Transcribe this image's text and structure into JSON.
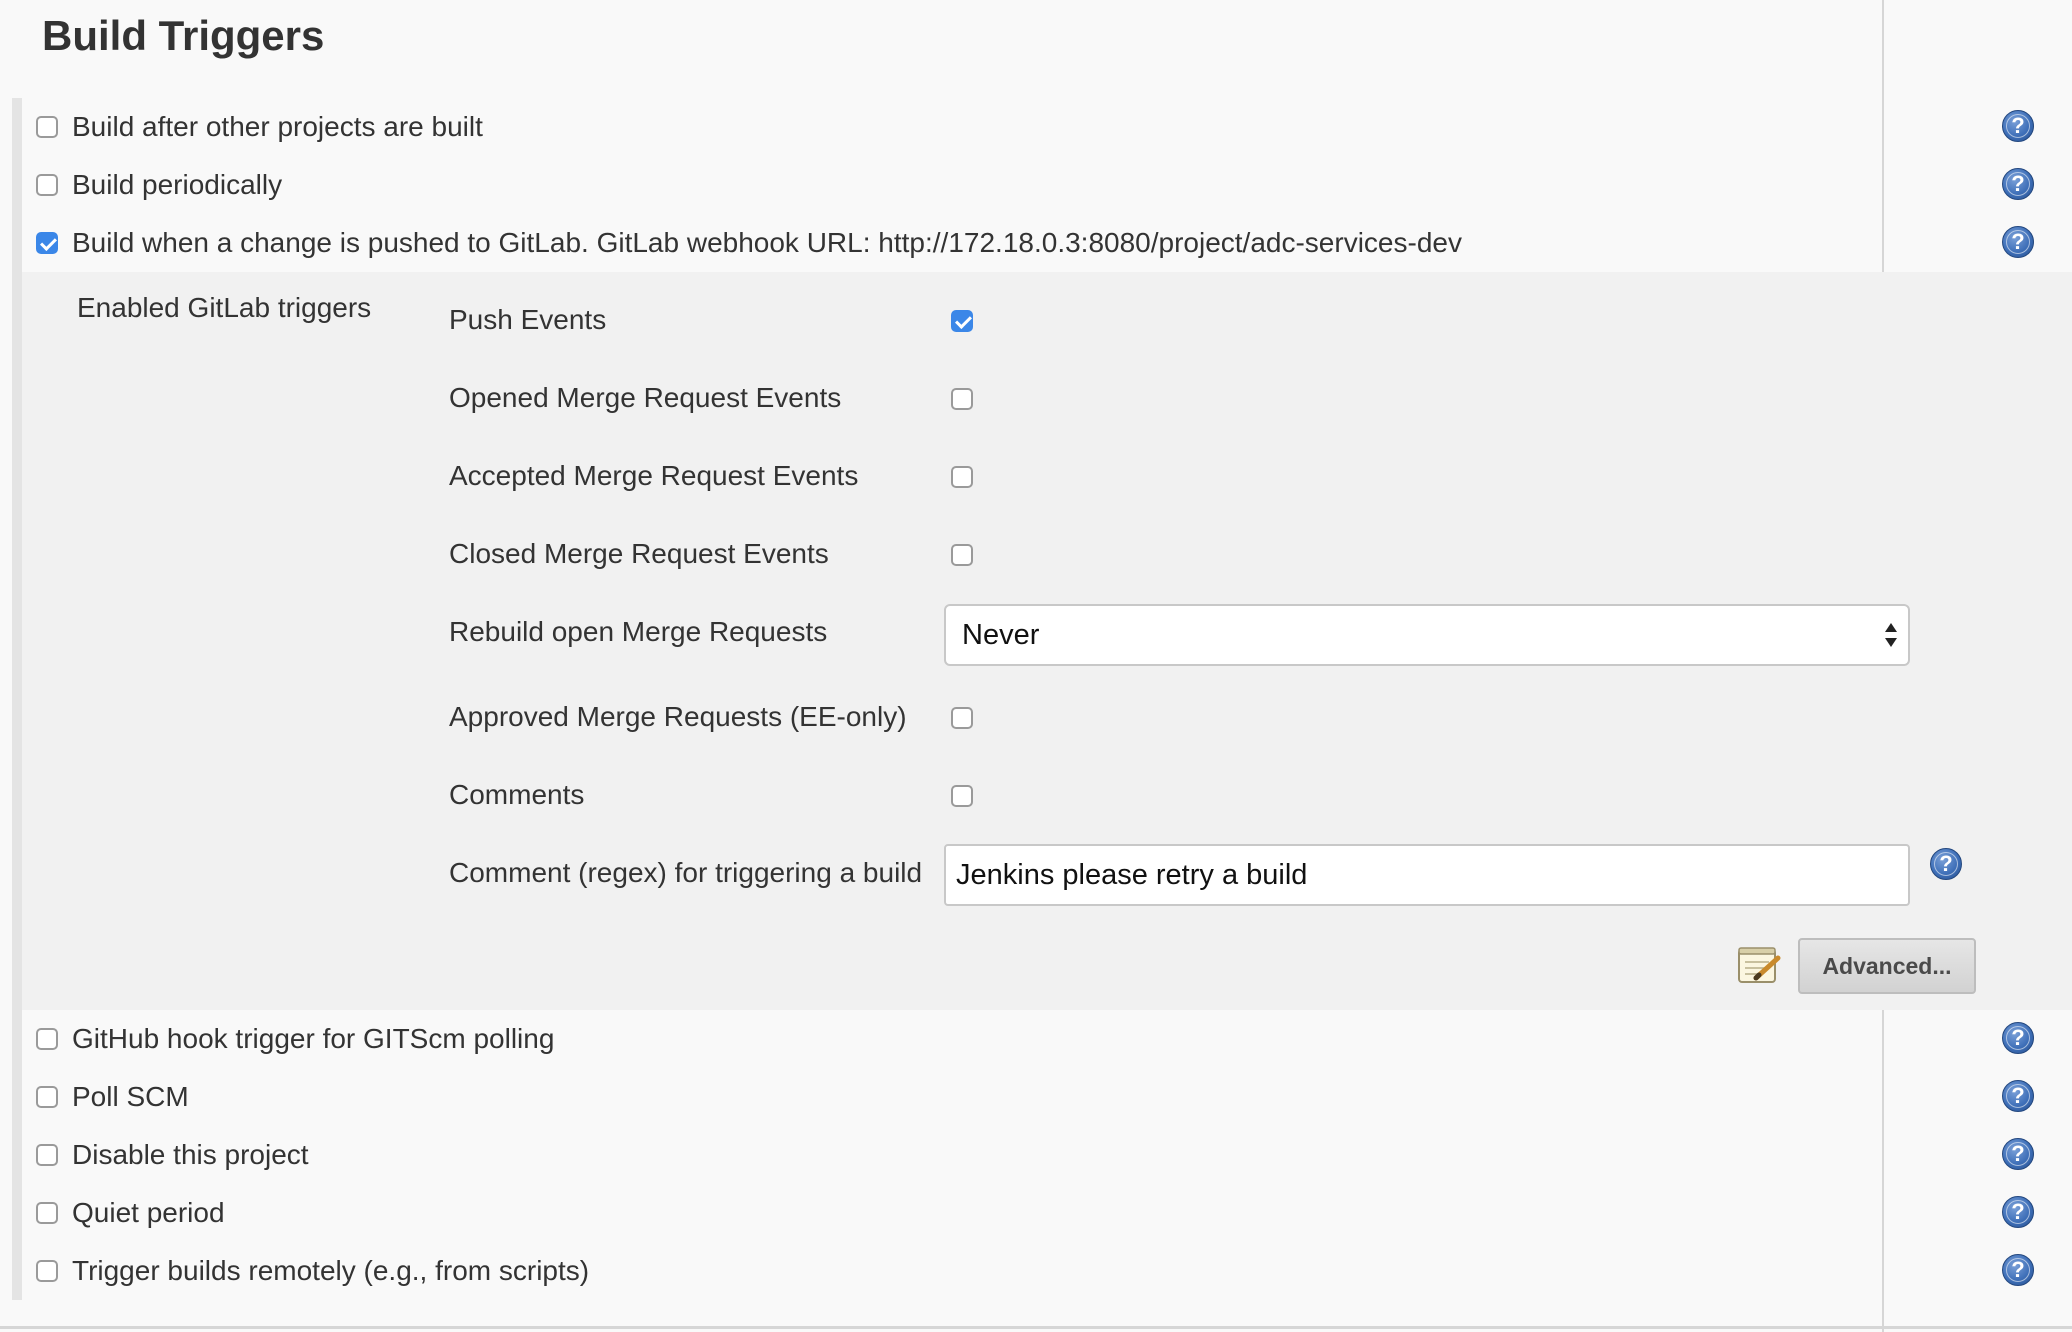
{
  "section": {
    "title": "Build Triggers"
  },
  "triggers_top": [
    {
      "label": "Build after other projects are built",
      "checked": false
    },
    {
      "label": "Build periodically",
      "checked": false
    },
    {
      "label": "Build when a change is pushed to GitLab. GitLab webhook URL: http://172.18.0.3:8080/project/adc-services-dev",
      "checked": true
    }
  ],
  "gitlab": {
    "enabled_label": "Enabled GitLab triggers",
    "push_events": {
      "label": "Push Events",
      "checked": true
    },
    "opened_mr_events": {
      "label": "Opened Merge Request Events",
      "checked": false
    },
    "accepted_mr_events": {
      "label": "Accepted Merge Request Events",
      "checked": false
    },
    "closed_mr_events": {
      "label": "Closed Merge Request Events",
      "checked": false
    },
    "rebuild_open_mr": {
      "label": "Rebuild open Merge Requests",
      "value": "Never"
    },
    "approved_mr": {
      "label": "Approved Merge Requests (EE-only)",
      "checked": false
    },
    "comments": {
      "label": "Comments",
      "checked": false
    },
    "comment_regex": {
      "label": "Comment (regex) for triggering a build",
      "value": "Jenkins please retry a build"
    },
    "advanced_label": "Advanced..."
  },
  "triggers_bottom": [
    {
      "label": "GitHub hook trigger for GITScm polling",
      "checked": false
    },
    {
      "label": "Poll SCM",
      "checked": false
    },
    {
      "label": "Disable this project",
      "checked": false
    },
    {
      "label": "Quiet period",
      "checked": false
    },
    {
      "label": "Trigger builds remotely (e.g., from scripts)",
      "checked": false
    }
  ],
  "help_icon_glyph": "?",
  "colors": {
    "checkbox_checked": "#3b87e8",
    "help_icon": "#3e6fb8",
    "panel_bg": "#f1f1f1",
    "page_bg": "#f9f9f9"
  }
}
